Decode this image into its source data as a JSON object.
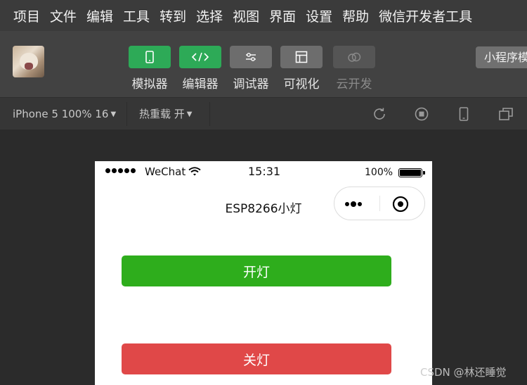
{
  "menubar": {
    "items": [
      "项目",
      "文件",
      "编辑",
      "工具",
      "转到",
      "选择",
      "视图",
      "界面",
      "设置",
      "帮助",
      "微信开发者工具"
    ]
  },
  "toolbar": {
    "tools": [
      {
        "label": "模拟器",
        "icon": "phone-icon",
        "state": "active"
      },
      {
        "label": "编辑器",
        "icon": "code-icon",
        "state": "active"
      },
      {
        "label": "调试器",
        "icon": "sliders-icon",
        "state": "normal"
      },
      {
        "label": "可视化",
        "icon": "layout-icon",
        "state": "normal"
      },
      {
        "label": "云开发",
        "icon": "cloud-icon",
        "state": "disabled"
      }
    ],
    "mini_program_label": "小程序模",
    "colors": {
      "active": "#2daa57",
      "normal": "#6d6d6d",
      "disabled": "#555555"
    }
  },
  "subbar": {
    "device": "iPhone 5 100% 16",
    "hot_reload": "热重载 开",
    "icons": [
      "refresh-icon",
      "stop-icon",
      "phone-preview-icon",
      "window-icon"
    ]
  },
  "phone": {
    "status": {
      "carrier": "WeChat",
      "time": "15:31",
      "battery": "100%"
    },
    "nav_title": "ESP8266小灯",
    "buttons": {
      "on_label": "开灯",
      "off_label": "关灯",
      "on_color": "#2ead1c",
      "off_color": "#e04848"
    }
  },
  "watermark": "CSDN @林还睡觉"
}
